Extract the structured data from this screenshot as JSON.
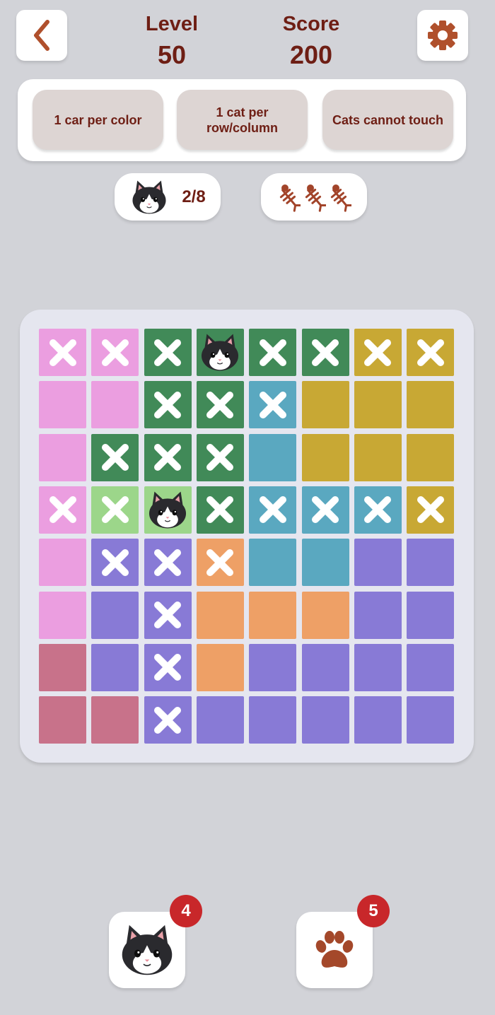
{
  "header": {
    "level_label": "Level",
    "level_value": "50",
    "score_label": "Score",
    "score_value": "200"
  },
  "rules": [
    "1 car per color",
    "1 cat per row/column",
    "Cats cannot touch"
  ],
  "counter": {
    "cats_placed": "2/8"
  },
  "lives": {
    "remaining": 3,
    "icon": "fish-bone-icon"
  },
  "colors": {
    "accent": "#6e1e14",
    "pink": "#eb9ee0",
    "dark-green": "#418a58",
    "gold": "#c8a834",
    "teal": "#5aa8c0",
    "light-green": "#9cd68a",
    "purple": "#887ad6",
    "orange": "#eea066",
    "rose": "#c8728a",
    "badge": "#c8272a"
  },
  "board": {
    "rows": [
      [
        {
          "c": "pink",
          "m": "x"
        },
        {
          "c": "pink",
          "m": "x"
        },
        {
          "c": "dark-green",
          "m": "x"
        },
        {
          "c": "dark-green",
          "m": "cat"
        },
        {
          "c": "dark-green",
          "m": "x"
        },
        {
          "c": "dark-green",
          "m": "x"
        },
        {
          "c": "gold",
          "m": "x"
        },
        {
          "c": "gold",
          "m": "x"
        }
      ],
      [
        {
          "c": "pink",
          "m": ""
        },
        {
          "c": "pink",
          "m": ""
        },
        {
          "c": "dark-green",
          "m": "x"
        },
        {
          "c": "dark-green",
          "m": "x"
        },
        {
          "c": "teal",
          "m": "x"
        },
        {
          "c": "gold",
          "m": ""
        },
        {
          "c": "gold",
          "m": ""
        },
        {
          "c": "gold",
          "m": ""
        }
      ],
      [
        {
          "c": "pink",
          "m": ""
        },
        {
          "c": "dark-green",
          "m": "x"
        },
        {
          "c": "dark-green",
          "m": "x"
        },
        {
          "c": "dark-green",
          "m": "x"
        },
        {
          "c": "teal",
          "m": ""
        },
        {
          "c": "gold",
          "m": ""
        },
        {
          "c": "gold",
          "m": ""
        },
        {
          "c": "gold",
          "m": ""
        }
      ],
      [
        {
          "c": "pink",
          "m": "x"
        },
        {
          "c": "light-green",
          "m": "x"
        },
        {
          "c": "light-green",
          "m": "cat"
        },
        {
          "c": "dark-green",
          "m": "x"
        },
        {
          "c": "teal",
          "m": "x"
        },
        {
          "c": "teal",
          "m": "x"
        },
        {
          "c": "teal",
          "m": "x"
        },
        {
          "c": "gold",
          "m": "x"
        }
      ],
      [
        {
          "c": "pink",
          "m": ""
        },
        {
          "c": "purple",
          "m": "x"
        },
        {
          "c": "purple",
          "m": "x"
        },
        {
          "c": "orange",
          "m": "x"
        },
        {
          "c": "teal",
          "m": ""
        },
        {
          "c": "teal",
          "m": ""
        },
        {
          "c": "purple",
          "m": ""
        },
        {
          "c": "purple",
          "m": ""
        }
      ],
      [
        {
          "c": "pink",
          "m": ""
        },
        {
          "c": "purple",
          "m": ""
        },
        {
          "c": "purple",
          "m": "x"
        },
        {
          "c": "orange",
          "m": ""
        },
        {
          "c": "orange",
          "m": ""
        },
        {
          "c": "orange",
          "m": ""
        },
        {
          "c": "purple",
          "m": ""
        },
        {
          "c": "purple",
          "m": ""
        }
      ],
      [
        {
          "c": "rose",
          "m": ""
        },
        {
          "c": "purple",
          "m": ""
        },
        {
          "c": "purple",
          "m": "x"
        },
        {
          "c": "orange",
          "m": ""
        },
        {
          "c": "purple",
          "m": ""
        },
        {
          "c": "purple",
          "m": ""
        },
        {
          "c": "purple",
          "m": ""
        },
        {
          "c": "purple",
          "m": ""
        }
      ],
      [
        {
          "c": "rose",
          "m": ""
        },
        {
          "c": "rose",
          "m": ""
        },
        {
          "c": "purple",
          "m": "x"
        },
        {
          "c": "purple",
          "m": ""
        },
        {
          "c": "purple",
          "m": ""
        },
        {
          "c": "purple",
          "m": ""
        },
        {
          "c": "purple",
          "m": ""
        },
        {
          "c": "purple",
          "m": ""
        }
      ]
    ]
  },
  "tools": {
    "cat_count": "4",
    "paw_count": "5"
  }
}
